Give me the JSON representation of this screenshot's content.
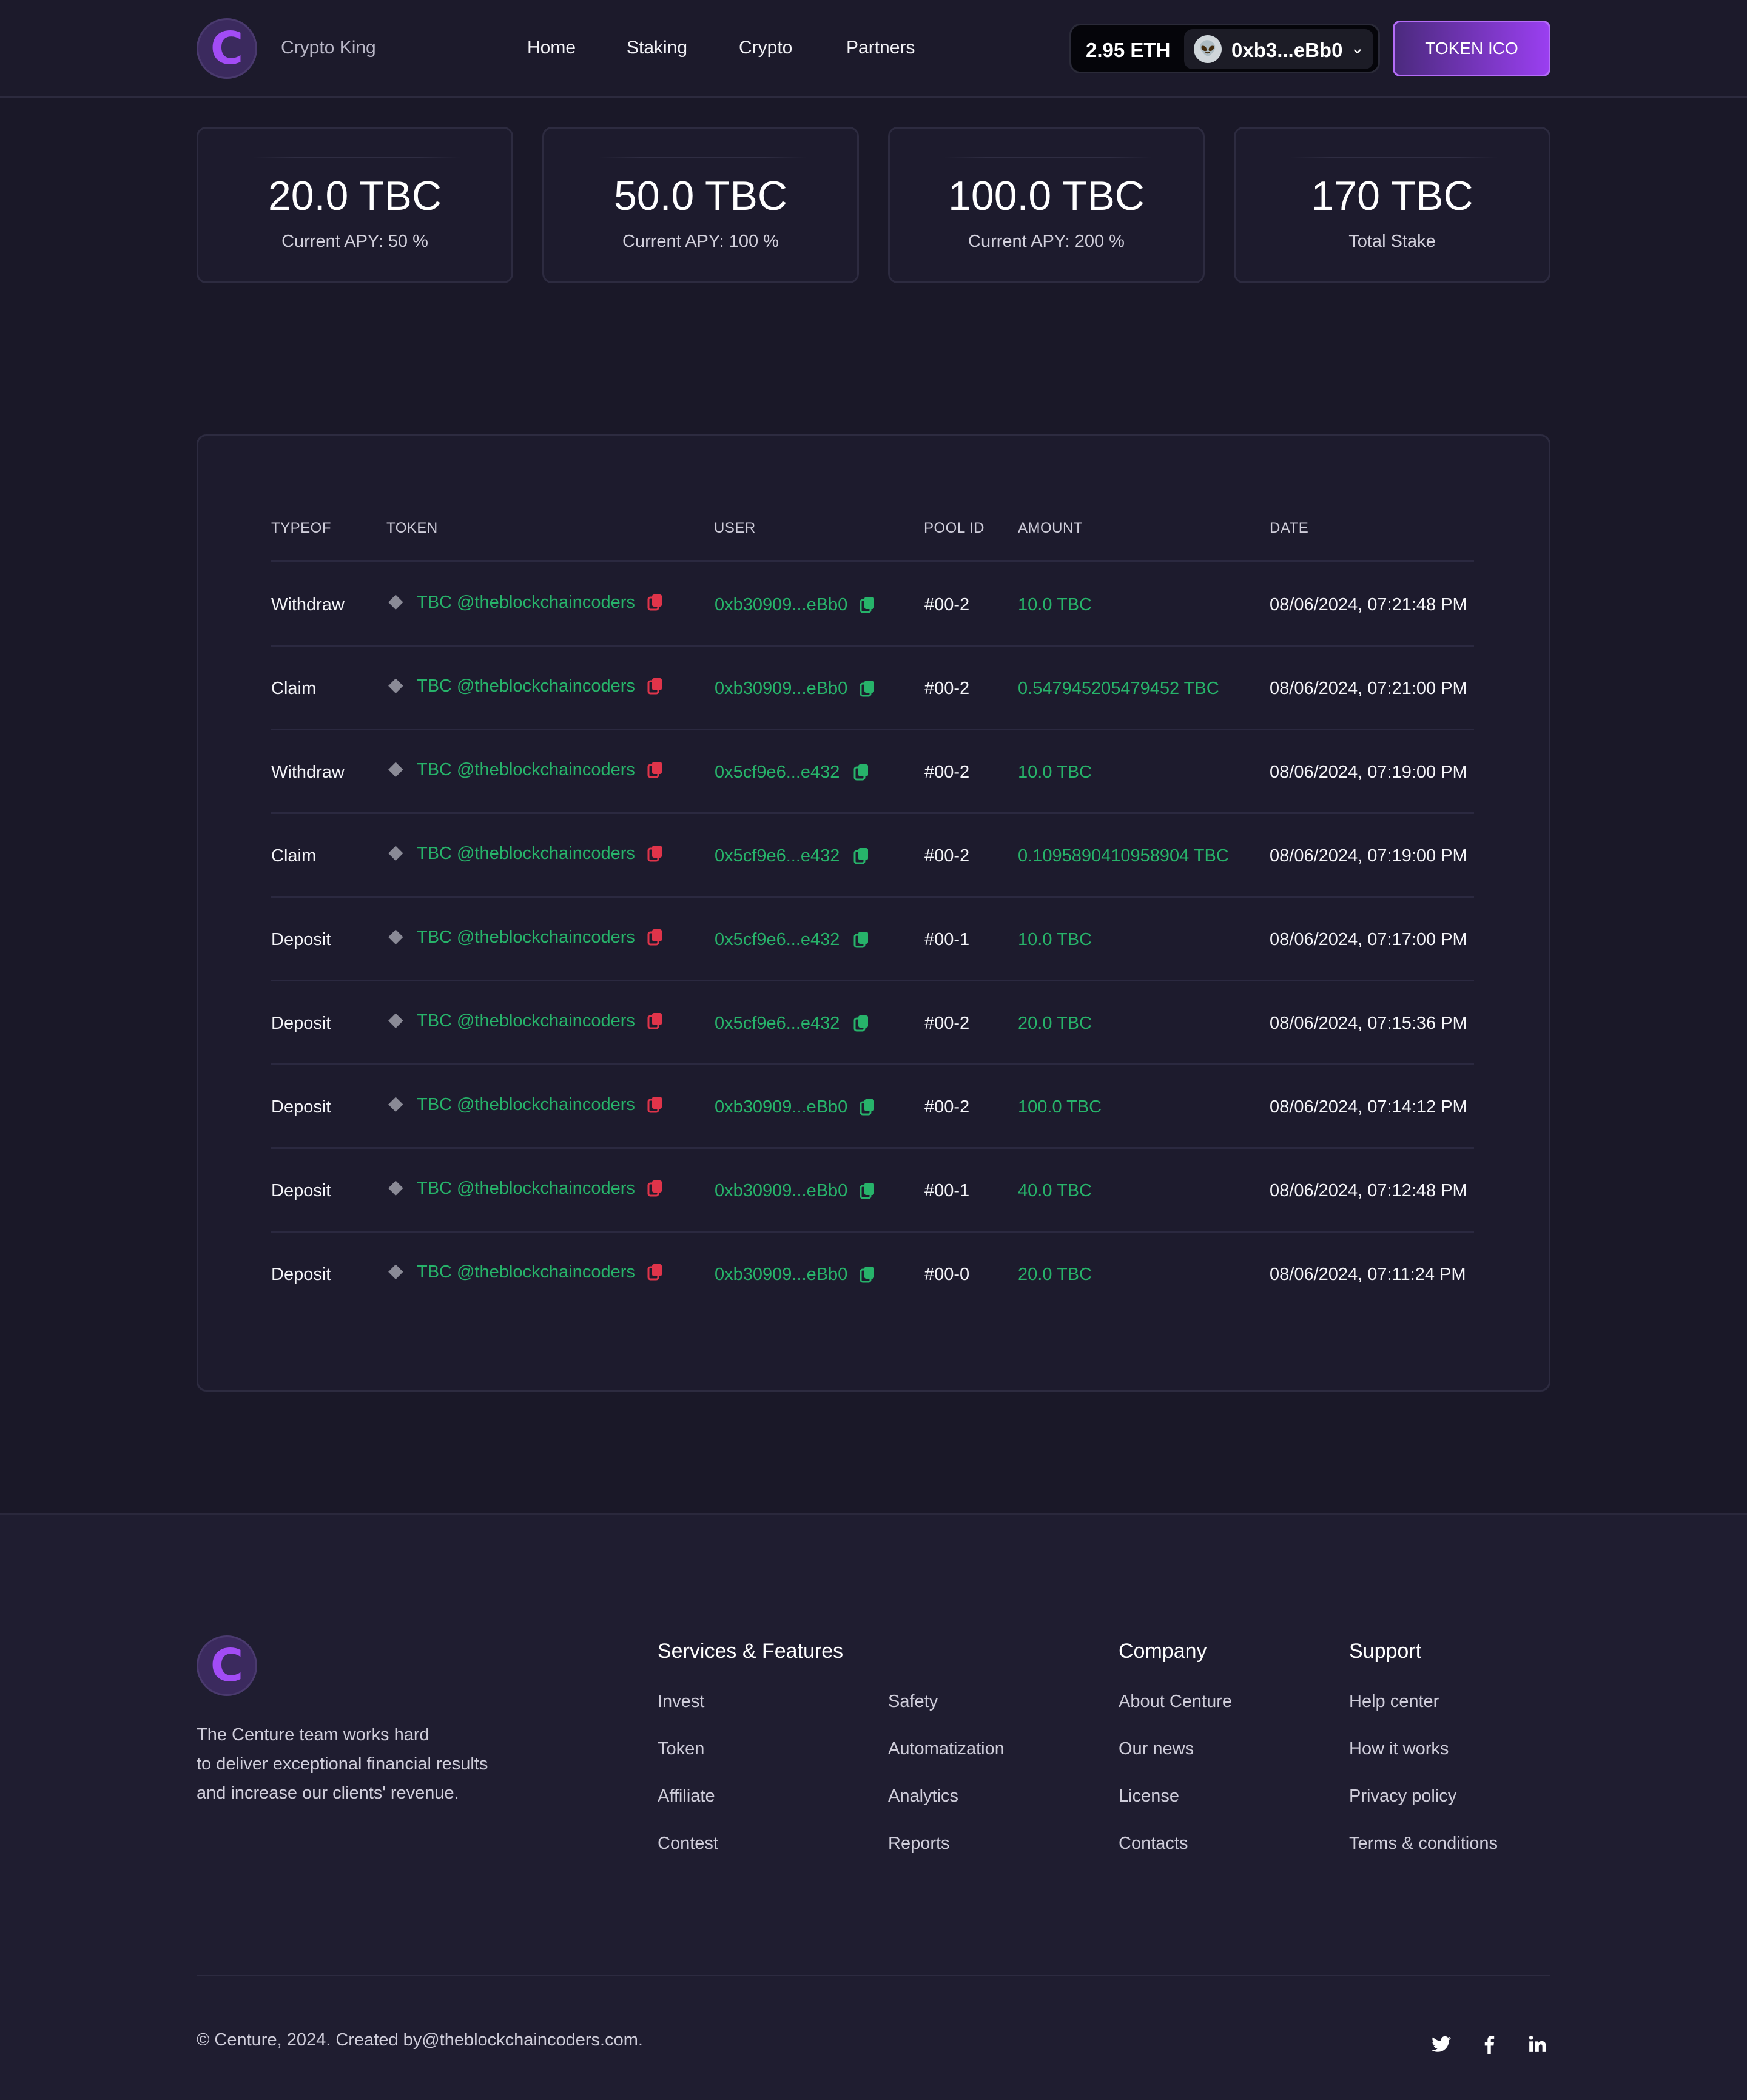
{
  "header": {
    "brand": "Crypto King",
    "nav": [
      "Home",
      "Staking",
      "Crypto",
      "Partners"
    ],
    "wallet": {
      "balance": "2.95 ETH",
      "address": "0xb3...eBb0"
    },
    "cta": "TOKEN ICO"
  },
  "stats": [
    {
      "value": "20.0 TBC",
      "label": "Current APY: 50 %"
    },
    {
      "value": "50.0 TBC",
      "label": "Current APY: 100 %"
    },
    {
      "value": "100.0 TBC",
      "label": "Current APY: 200 %"
    },
    {
      "value": "170  TBC",
      "label": "Total Stake"
    }
  ],
  "table": {
    "headers": [
      "TYPEOF",
      "TOKEN",
      "USER",
      "POOL ID",
      "AMOUNT",
      "DATE"
    ],
    "rows": [
      {
        "type": "Withdraw",
        "token": "TBC @theblockchaincoders",
        "user": "0xb30909...eBb0",
        "pool": "#00-2",
        "amount": "10.0 TBC",
        "date": "08/06/2024, 07:21:48 PM"
      },
      {
        "type": "Claim",
        "token": "TBC @theblockchaincoders",
        "user": "0xb30909...eBb0",
        "pool": "#00-2",
        "amount": "0.547945205479452 TBC",
        "date": "08/06/2024, 07:21:00 PM"
      },
      {
        "type": "Withdraw",
        "token": "TBC @theblockchaincoders",
        "user": "0x5cf9e6...e432",
        "pool": "#00-2",
        "amount": "10.0 TBC",
        "date": "08/06/2024, 07:19:00 PM"
      },
      {
        "type": "Claim",
        "token": "TBC @theblockchaincoders",
        "user": "0x5cf9e6...e432",
        "pool": "#00-2",
        "amount": "0.1095890410958904 TBC",
        "date": "08/06/2024, 07:19:00 PM"
      },
      {
        "type": "Deposit",
        "token": "TBC @theblockchaincoders",
        "user": "0x5cf9e6...e432",
        "pool": "#00-1",
        "amount": "10.0 TBC",
        "date": "08/06/2024, 07:17:00 PM"
      },
      {
        "type": "Deposit",
        "token": "TBC @theblockchaincoders",
        "user": "0x5cf9e6...e432",
        "pool": "#00-2",
        "amount": "20.0 TBC",
        "date": "08/06/2024, 07:15:36 PM"
      },
      {
        "type": "Deposit",
        "token": "TBC @theblockchaincoders",
        "user": "0xb30909...eBb0",
        "pool": "#00-2",
        "amount": "100.0 TBC",
        "date": "08/06/2024, 07:14:12 PM"
      },
      {
        "type": "Deposit",
        "token": "TBC @theblockchaincoders",
        "user": "0xb30909...eBb0",
        "pool": "#00-1",
        "amount": "40.0 TBC",
        "date": "08/06/2024, 07:12:48 PM"
      },
      {
        "type": "Deposit",
        "token": "TBC @theblockchaincoders",
        "user": "0xb30909...eBb0",
        "pool": "#00-0",
        "amount": "20.0 TBC",
        "date": "08/06/2024, 07:11:24 PM"
      }
    ]
  },
  "footer": {
    "description": [
      "The Centure team works hard",
      "to deliver exceptional financial results",
      "and increase our clients' revenue."
    ],
    "services_title": "Services & Features",
    "services_col1": [
      "Invest",
      "Token",
      "Affiliate",
      "Contest"
    ],
    "services_col2": [
      "Safety",
      "Automatization",
      "Analytics",
      "Reports"
    ],
    "company_title": "Company",
    "company": [
      "About Centure",
      "Our news",
      "License",
      "Contacts"
    ],
    "support_title": "Support",
    "support": [
      "Help center",
      "How it works",
      "Privacy policy",
      "Terms & conditions"
    ],
    "copyright": "© Centure, 2024. Created by@theblockchaincoders.com.",
    "social": [
      "twitter-icon",
      "facebook-icon",
      "linkedin-icon"
    ]
  },
  "colors": {
    "accent": "#9a3ff0",
    "green": "#27b36a",
    "red": "#e0344a",
    "background": "#1a1828"
  }
}
